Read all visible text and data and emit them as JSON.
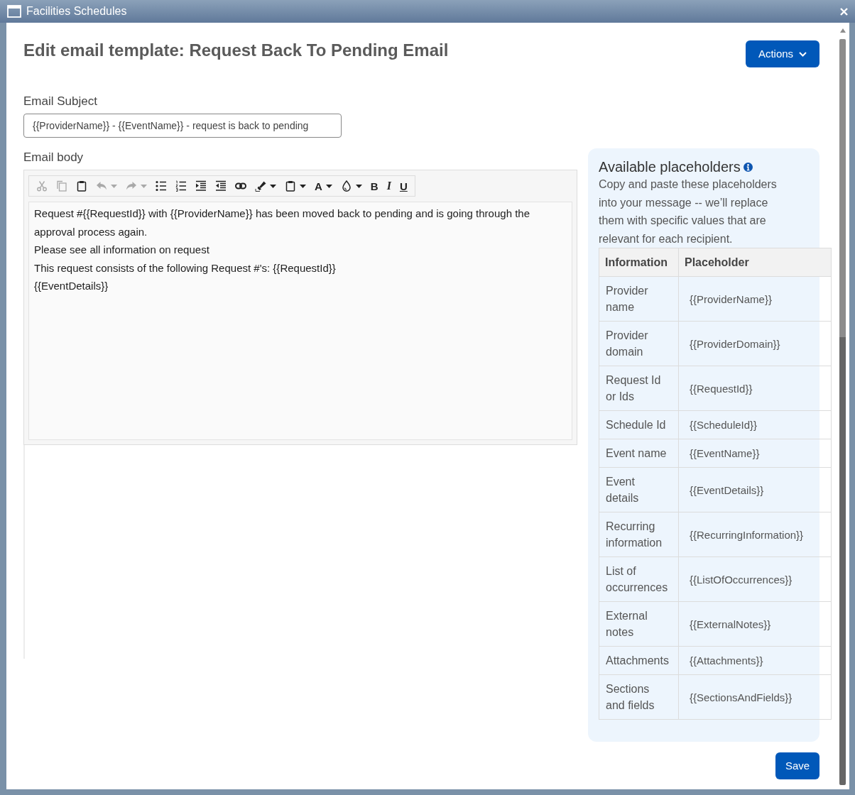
{
  "window": {
    "title": "Facilities Schedules"
  },
  "page": {
    "heading": "Edit email template: Request Back To Pending Email",
    "actions_button": "Actions"
  },
  "subject": {
    "label": "Email Subject",
    "value": "{{ProviderName}} - {{EventName}} - request is back to pending"
  },
  "body": {
    "label": "Email body",
    "toolbar": [
      {
        "kind": "cut",
        "disabled": true,
        "dropdown": false
      },
      {
        "kind": "copy",
        "disabled": true,
        "dropdown": false
      },
      {
        "kind": "paste",
        "disabled": false,
        "dropdown": false
      },
      {
        "kind": "undo",
        "disabled": true,
        "dropdown": true
      },
      {
        "kind": "redo",
        "disabled": true,
        "dropdown": true
      },
      {
        "kind": "bulleted-list",
        "disabled": false,
        "dropdown": false
      },
      {
        "kind": "numbered-list",
        "disabled": false,
        "dropdown": false
      },
      {
        "kind": "indent",
        "disabled": false,
        "dropdown": false
      },
      {
        "kind": "outdent",
        "disabled": false,
        "dropdown": false
      },
      {
        "kind": "link",
        "disabled": false,
        "dropdown": false
      },
      {
        "kind": "highlight",
        "disabled": false,
        "dropdown": true
      },
      {
        "kind": "paste-special",
        "disabled": false,
        "dropdown": true
      },
      {
        "kind": "font-color",
        "label": "A",
        "disabled": false,
        "dropdown": true
      },
      {
        "kind": "background-color",
        "disabled": false,
        "dropdown": true
      },
      {
        "kind": "bold",
        "label": "B",
        "disabled": false,
        "dropdown": false
      },
      {
        "kind": "italic",
        "label": "I",
        "disabled": false,
        "dropdown": false
      },
      {
        "kind": "underline",
        "label": "U",
        "disabled": false,
        "dropdown": false
      }
    ],
    "lines": [
      "Request #{{RequestId}} with {{ProviderName}} has been moved back to pending and is going through the approval process again.",
      "Please see all information on request",
      "This request consists of the following Request #'s: {{RequestId}}",
      "{{EventDetails}}"
    ]
  },
  "placeholders_panel": {
    "title": "Available placeholders",
    "description": "Copy and paste these placeholders into your message -- we’ll replace them with specific values that are relevant for each recipient.",
    "table": {
      "columns": [
        "Information",
        "Placeholder"
      ],
      "rows": [
        [
          "Provider name",
          "{{ProviderName}}"
        ],
        [
          "Provider domain",
          "{{ProviderDomain}}"
        ],
        [
          "Request Id or Ids",
          "{{RequestId}}"
        ],
        [
          "Schedule Id",
          "{{ScheduleId}}"
        ],
        [
          "Event name",
          "{{EventName}}"
        ],
        [
          "Event details",
          "{{EventDetails}}"
        ],
        [
          "Recurring information",
          "{{RecurringInformation}}"
        ],
        [
          "List of occurrences",
          "{{ListOfOccurrences}}"
        ],
        [
          "External notes",
          "{{ExternalNotes}}"
        ],
        [
          "Attachments",
          "{{Attachments}}"
        ],
        [
          "Sections and fields",
          "{{SectionsAndFields}}"
        ]
      ]
    }
  },
  "save_button": "Save"
}
